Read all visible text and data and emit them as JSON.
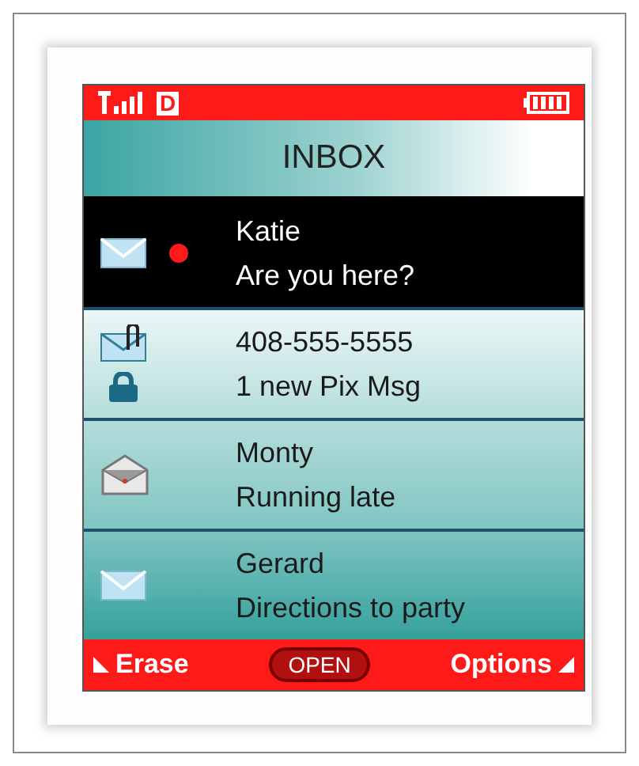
{
  "status_bar": {
    "roaming_letter": "D"
  },
  "title": "INBOX",
  "messages": [
    {
      "sender": "Katie",
      "preview": "Are you here?",
      "kind": "envelope",
      "urgent": true,
      "locked": false,
      "selected": true
    },
    {
      "sender": "408-555-5555",
      "preview": "1 new Pix Msg",
      "kind": "attachment",
      "urgent": false,
      "locked": true,
      "selected": false
    },
    {
      "sender": "Monty",
      "preview": "Running late",
      "kind": "opened",
      "urgent": false,
      "locked": false,
      "selected": false
    },
    {
      "sender": "Gerard",
      "preview": "Directions to party",
      "kind": "envelope",
      "urgent": false,
      "locked": false,
      "selected": false
    }
  ],
  "softkeys": {
    "left": "Erase",
    "center": "OPEN",
    "right": "Options"
  }
}
